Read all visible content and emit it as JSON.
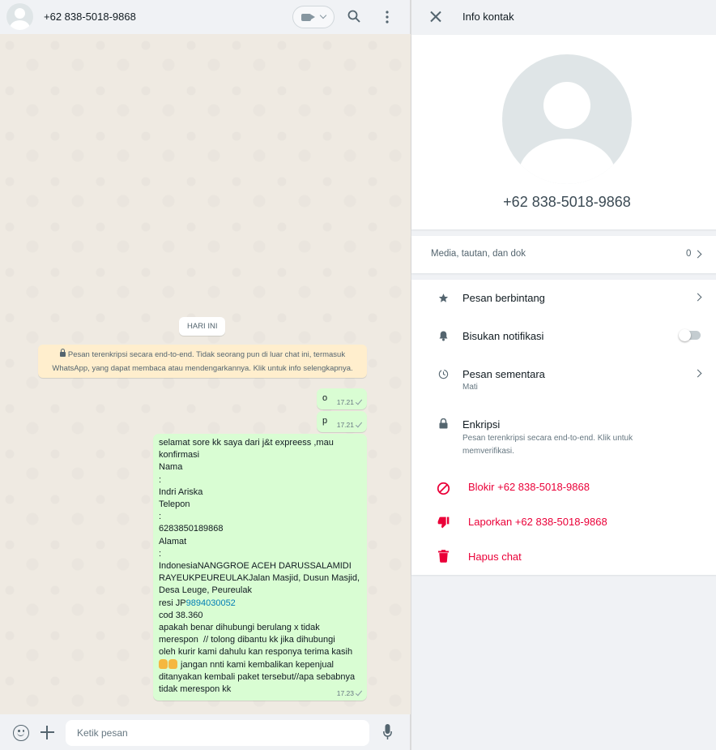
{
  "chat": {
    "contact_name": "+62 838-5018-9868",
    "day_chip": "HARI INI",
    "encryption_notice": "Pesan terenkripsi secara end-to-end. Tidak seorang pun di luar chat ini, termasuk WhatsApp, yang dapat membaca atau mendengarkannya. Klik untuk info selengkapnya.",
    "messages": [
      {
        "text": "o",
        "time": "17.21"
      },
      {
        "text": "p",
        "time": "17.21"
      },
      {
        "time": "17.23",
        "lines": [
          "selamat sore kk saya dari j&t expreess ,mau",
          "konfirmasi",
          "Nama",
          ":",
          "Indri Ariska",
          "Telepon",
          ":",
          "6283850189868",
          "Alamat",
          ":",
          "IndonesiaNANGGROE ACEH DARUSSALAMIDI",
          "RAYEUKPEUREULAKJalan Masjid, Dusun Masjid,",
          "Desa Leuge, Peureulak",
          "resi JP",
          "9894030052",
          "cod 38.360",
          "apakah benar dihubungi berulang x tidak",
          "merespon  // tolong dibantu kk jika dihubungi",
          "oleh kurir kami dahulu kan responya terima kasih",
          " jangan nnti kami kembalikan kepenjual",
          "ditanyakan kembali paket tersebut//apa sebabnya",
          "tidak merespon kk"
        ]
      }
    ],
    "composer_placeholder": "Ketik pesan"
  },
  "info": {
    "title": "Info kontak",
    "contact_name": "+62 838-5018-9868",
    "media_label": "Media, tautan, dan dok",
    "media_count": "0",
    "starred_label": "Pesan berbintang",
    "mute_label": "Bisukan notifikasi",
    "mute_enabled": false,
    "disappearing_label": "Pesan sementara",
    "disappearing_sub": "Mati",
    "encryption_label": "Enkripsi",
    "encryption_sub_1": "Pesan terenkripsi secara end-to-end. Klik untuk",
    "encryption_sub_2": "memverifikasi.",
    "block_label": "Blokir +62 838-5018-9868",
    "report_label": "Laporkan +62 838-5018-9868",
    "delete_label": "Hapus chat"
  },
  "colors": {
    "bubble_out": "#d9fdd3",
    "chat_bg": "#efeae2",
    "notice_bg": "#ffeecd",
    "danger": "#ea0038",
    "link": "#027eb5"
  }
}
